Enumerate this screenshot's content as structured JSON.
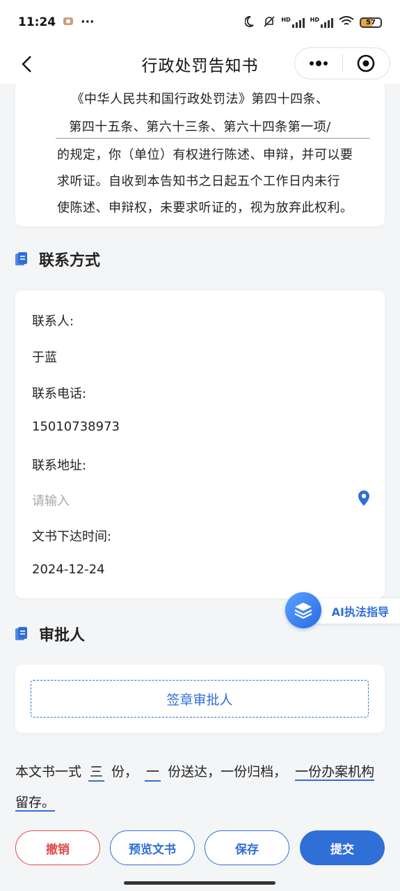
{
  "status_bar": {
    "time": "11:24",
    "dots": "···",
    "battery": "57",
    "hd1": "HD",
    "hd2": "HD"
  },
  "nav": {
    "title": "行政处罚告知书"
  },
  "legal": {
    "line1": "《中华人民共和国行政处罚法》第四十四条、",
    "line2": "第四十五条、第六十三条、第六十四条第一项/",
    "line3": "的规定，你（单位）有权进行陈述、申辩，并可以要",
    "line4": "求听证。自收到本告知书之日起五个工作日内未行",
    "line5": "使陈述、申辩权，未要求听证的，视为放弃此权利。"
  },
  "contact": {
    "section_title": "联系方式",
    "contact_person_label": "联系人:",
    "contact_person_value": "于蓝",
    "phone_label": "联系电话:",
    "phone_value": "15010738973",
    "address_label": "联系地址:",
    "address_placeholder": "请输入",
    "issue_date_label": "文书下达时间:",
    "issue_date_value": "2024-12-24"
  },
  "approver": {
    "section_title": "审批人",
    "sign_button": "签章审批人"
  },
  "ai_assist": {
    "label": "AI执法指导"
  },
  "copies": {
    "prefix": "本文书一式",
    "total": "三",
    "unit1": "份，",
    "served": "一",
    "rest": "份送达，一份归档，",
    "retained": "一份办案机构留存。"
  },
  "actions": {
    "cancel": "撤销",
    "preview": "预览文书",
    "save": "保存",
    "submit": "提交"
  },
  "colors": {
    "accent": "#2f6fd6",
    "danger": "#e24a4a",
    "background": "#f4f5f7"
  }
}
